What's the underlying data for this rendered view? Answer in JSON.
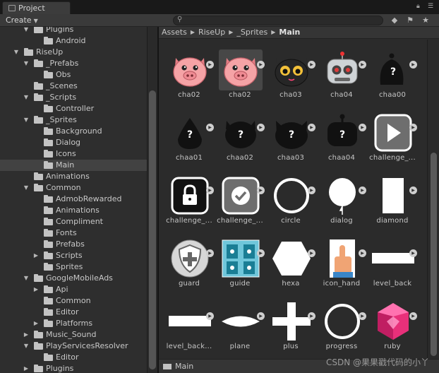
{
  "window": {
    "tab_label": "Project",
    "tab_icon": "project-icon",
    "controls": [
      "lock-icon",
      "menu-icon"
    ]
  },
  "toolbar": {
    "create_label": "Create",
    "search_placeholder": "",
    "icons": [
      "scene-filter-icon",
      "label-tag-icon",
      "favorites-star-icon"
    ]
  },
  "tree": {
    "selected": "Main",
    "items": [
      {
        "label": "Plugins",
        "depth": 2,
        "expanded": true,
        "has_children": true
      },
      {
        "label": "Android",
        "depth": 3,
        "expanded": false,
        "has_children": false
      },
      {
        "label": "RiseUp",
        "depth": 1,
        "expanded": true,
        "has_children": true
      },
      {
        "label": "_Prefabs",
        "depth": 2,
        "expanded": true,
        "has_children": true
      },
      {
        "label": "Obs",
        "depth": 3,
        "expanded": false,
        "has_children": false
      },
      {
        "label": "_Scenes",
        "depth": 2,
        "expanded": false,
        "has_children": false
      },
      {
        "label": "_Scripts",
        "depth": 2,
        "expanded": true,
        "has_children": true
      },
      {
        "label": "Controller",
        "depth": 3,
        "expanded": false,
        "has_children": false
      },
      {
        "label": "_Sprites",
        "depth": 2,
        "expanded": true,
        "has_children": true
      },
      {
        "label": "Background",
        "depth": 3,
        "expanded": false,
        "has_children": false
      },
      {
        "label": "Dialog",
        "depth": 3,
        "expanded": false,
        "has_children": false
      },
      {
        "label": "Icons",
        "depth": 3,
        "expanded": false,
        "has_children": false
      },
      {
        "label": "Main",
        "depth": 3,
        "expanded": false,
        "has_children": false
      },
      {
        "label": "Animations",
        "depth": 2,
        "expanded": false,
        "has_children": false
      },
      {
        "label": "Common",
        "depth": 2,
        "expanded": true,
        "has_children": true
      },
      {
        "label": "AdmobRewarded",
        "depth": 3,
        "expanded": false,
        "has_children": false
      },
      {
        "label": "Animations",
        "depth": 3,
        "expanded": false,
        "has_children": false
      },
      {
        "label": "Compliment",
        "depth": 3,
        "expanded": false,
        "has_children": false
      },
      {
        "label": "Fonts",
        "depth": 3,
        "expanded": false,
        "has_children": false
      },
      {
        "label": "Prefabs",
        "depth": 3,
        "expanded": false,
        "has_children": false
      },
      {
        "label": "Scripts",
        "depth": 3,
        "expanded": false,
        "has_children": true
      },
      {
        "label": "Sprites",
        "depth": 3,
        "expanded": false,
        "has_children": false
      },
      {
        "label": "GoogleMobileAds",
        "depth": 2,
        "expanded": true,
        "has_children": true
      },
      {
        "label": "Api",
        "depth": 3,
        "expanded": false,
        "has_children": true
      },
      {
        "label": "Common",
        "depth": 3,
        "expanded": false,
        "has_children": false
      },
      {
        "label": "Editor",
        "depth": 3,
        "expanded": false,
        "has_children": false
      },
      {
        "label": "Platforms",
        "depth": 3,
        "expanded": false,
        "has_children": true
      },
      {
        "label": "Music_Sound",
        "depth": 2,
        "expanded": false,
        "has_children": true
      },
      {
        "label": "PlayServicesResolver",
        "depth": 2,
        "expanded": true,
        "has_children": true
      },
      {
        "label": "Editor",
        "depth": 3,
        "expanded": false,
        "has_children": false
      },
      {
        "label": "Plugins",
        "depth": 2,
        "expanded": false,
        "has_children": true
      }
    ]
  },
  "breadcrumb": [
    "Assets",
    "RiseUp",
    "_Sprites",
    "Main"
  ],
  "assets": [
    {
      "label": "cha02",
      "icon": "pig-face-icon",
      "selected": false
    },
    {
      "label": "cha02",
      "icon": "pig-face-icon",
      "selected": true
    },
    {
      "label": "cha03",
      "icon": "black-cat-face-icon",
      "selected": false
    },
    {
      "label": "cha04",
      "icon": "robot-face-icon",
      "selected": false
    },
    {
      "label": "chaa00",
      "icon": "mystery-silhouette-icon",
      "selected": false
    },
    {
      "label": "chaa01",
      "icon": "mystery-drop-silhouette-icon",
      "selected": false
    },
    {
      "label": "chaa02",
      "icon": "mystery-pig-silhouette-icon",
      "selected": false
    },
    {
      "label": "chaa03",
      "icon": "mystery-cat-silhouette-icon",
      "selected": false
    },
    {
      "label": "chaa04",
      "icon": "mystery-robot-silhouette-icon",
      "selected": false
    },
    {
      "label": "challenge_...",
      "icon": "play-button-icon",
      "selected": false
    },
    {
      "label": "challenge_...",
      "icon": "lock-button-icon",
      "selected": false
    },
    {
      "label": "challenge_...",
      "icon": "check-button-icon",
      "selected": false
    },
    {
      "label": "circle",
      "icon": "circle-ring-icon",
      "selected": false
    },
    {
      "label": "dialog",
      "icon": "balloon-icon",
      "selected": false
    },
    {
      "label": "diamond",
      "icon": "white-rectangle-icon",
      "selected": false
    },
    {
      "label": "guard",
      "icon": "shield-plus-icon",
      "selected": false
    },
    {
      "label": "guide",
      "icon": "phone-guide-icon",
      "selected": false
    },
    {
      "label": "hexa",
      "icon": "hexagon-icon",
      "selected": false
    },
    {
      "label": "icon_hand",
      "icon": "pointing-hand-icon",
      "selected": false
    },
    {
      "label": "level_back",
      "icon": "horizontal-bar-icon",
      "selected": false
    },
    {
      "label": "level_back...",
      "icon": "horizontal-bar-icon",
      "selected": false
    },
    {
      "label": "plane",
      "icon": "lens-shape-icon",
      "selected": false
    },
    {
      "label": "plus",
      "icon": "plus-cross-icon",
      "selected": false
    },
    {
      "label": "progress",
      "icon": "progress-ring-icon",
      "selected": false
    },
    {
      "label": "ruby",
      "icon": "pink-gem-icon",
      "selected": false
    }
  ],
  "footer": {
    "label": "Main"
  },
  "watermark": "CSDN @果果戳代码的小丫",
  "colors": {
    "panel_bg": "#2b2b2b",
    "tree_bg": "#2e2e2e",
    "selection": "#424242",
    "pig_pink": "#f5a3a6",
    "ruby_pink": "#e8307a"
  }
}
